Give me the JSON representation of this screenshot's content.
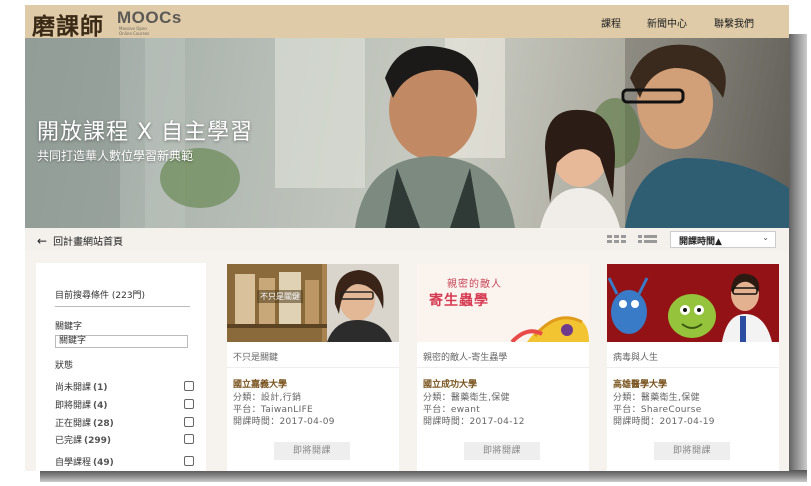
{
  "header": {
    "logo_text": "磨課師",
    "logo_brand": "MOOCs",
    "logo_sub": "Massive Open Online Courses",
    "nav": [
      "課程",
      "新聞中心",
      "聯繫我們"
    ]
  },
  "banner": {
    "title": "開放課程 X 自主學習",
    "subtitle": "共同打造華人數位學習新典範"
  },
  "toolbar": {
    "back_label": "回計畫網站首頁",
    "sort_label": "開課時間▲"
  },
  "filter": {
    "title": "目前搜尋條件 (223門)",
    "keyword_label": "關鍵字",
    "keyword_value": "關鍵字",
    "status_label": "狀態",
    "options": [
      {
        "label": "尚未開課",
        "count": "(1)"
      },
      {
        "label": "即將開課",
        "count": "(4)"
      },
      {
        "label": "正在開課",
        "count": "(28)"
      },
      {
        "label": "已完課",
        "count": "(299)"
      },
      {
        "label": "自學課程",
        "count": "(49)"
      }
    ]
  },
  "courses": [
    {
      "title": "不只是關鍵",
      "thumb_text": "不只是關鍵",
      "school": "國立嘉義大學",
      "category": "分類：設計,行銷",
      "platform": "平台：TaiwanLIFE",
      "date": "開課時間：2017-04-09",
      "button": "即將開課"
    },
    {
      "title": "親密的敵人-寄生蟲學",
      "thumb_text": "親密的敵人",
      "thumb_text2": "寄生蟲學",
      "school": "國立成功大學",
      "category": "分類：醫藥衛生,保健",
      "platform": "平台：ewant",
      "date": "開課時間：2017-04-12",
      "button": "即將開課"
    },
    {
      "title": "病毒與人生",
      "school": "高雄醫學大學",
      "category": "分類：醫藥衛生,保健",
      "platform": "平台：ShareCourse",
      "date": "開課時間：2017-04-19",
      "button": "即將開課"
    }
  ]
}
